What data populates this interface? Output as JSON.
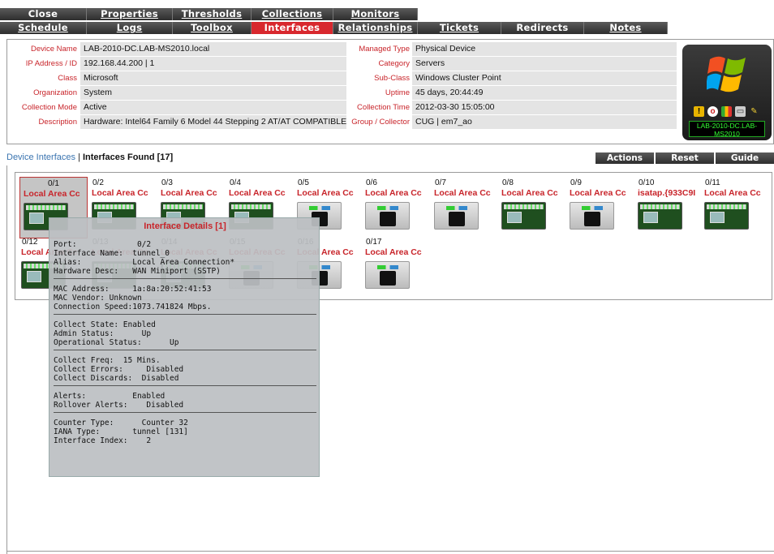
{
  "tabs_row1": [
    {
      "label": "Close",
      "underline": false
    },
    {
      "label": "Properties",
      "underline": true
    },
    {
      "label": "Thresholds",
      "underline": true
    },
    {
      "label": "Collections",
      "underline": true
    },
    {
      "label": "Monitors",
      "underline": true
    }
  ],
  "tabs_row2": [
    {
      "label": "Schedule",
      "underline": true,
      "active": false
    },
    {
      "label": "Logs",
      "underline": true,
      "active": false
    },
    {
      "label": "Toolbox",
      "underline": true,
      "active": false
    },
    {
      "label": "Interfaces",
      "underline": false,
      "active": true
    },
    {
      "label": "Relationships",
      "underline": true,
      "active": false
    },
    {
      "label": "Tickets",
      "underline": true,
      "active": false
    },
    {
      "label": "Redirects",
      "underline": false,
      "active": false
    },
    {
      "label": "Notes",
      "underline": true,
      "active": false
    }
  ],
  "device": {
    "left": [
      {
        "label": "Device Name",
        "value": "LAB-2010-DC.LAB-MS2010.local"
      },
      {
        "label": "IP Address / ID",
        "value": "192.168.44.200 | 1"
      },
      {
        "label": "Class",
        "value": "Microsoft"
      },
      {
        "label": "Organization",
        "value": "System"
      },
      {
        "label": "Collection Mode",
        "value": "Active"
      },
      {
        "label": "Description",
        "value": "Hardware: Intel64 Family 6 Model 44 Stepping 2 AT/AT COMPATIBLE -"
      }
    ],
    "right": [
      {
        "label": "Managed Type",
        "value": "Physical Device"
      },
      {
        "label": "Category",
        "value": "Servers"
      },
      {
        "label": "Sub-Class",
        "value": "Windows Cluster Point"
      },
      {
        "label": "Uptime",
        "value": "45 days, 20:44:49"
      },
      {
        "label": "Collection Time",
        "value": "2012-03-30 15:05:00"
      },
      {
        "label": "Group / Collector",
        "value": "CUG | em7_ao"
      }
    ],
    "badge_text": "LAB-2010-DC.LAB-MS2010"
  },
  "interfaces_header": {
    "link": "Device Interfaces",
    "separator": " | ",
    "found": "Interfaces Found [17]"
  },
  "header_buttons": {
    "actions": "Actions",
    "reset": "Reset",
    "guide": "Guide"
  },
  "interfaces": [
    {
      "num": "0/1",
      "name": "Local Area Cc",
      "type": "board"
    },
    {
      "num": "0/2",
      "name": "Local Area Cc",
      "type": "board"
    },
    {
      "num": "0/3",
      "name": "Local Area Cc",
      "type": "board"
    },
    {
      "num": "0/4",
      "name": "Local Area Cc",
      "type": "board"
    },
    {
      "num": "0/5",
      "name": "Local Area Cc",
      "type": "port"
    },
    {
      "num": "0/6",
      "name": "Local Area Cc",
      "type": "port"
    },
    {
      "num": "0/7",
      "name": "Local Area Cc",
      "type": "port"
    },
    {
      "num": "0/8",
      "name": "Local Area Cc",
      "type": "board"
    },
    {
      "num": "0/9",
      "name": "Local Area Cc",
      "type": "port"
    },
    {
      "num": "0/10",
      "name": "isatap.{933C9I",
      "type": "board"
    },
    {
      "num": "0/11",
      "name": "Local Area Cc",
      "type": "board"
    },
    {
      "num": "0/12",
      "name": "Local Area Cc",
      "type": "board"
    },
    {
      "num": "0/13",
      "name": "Local Area Cc",
      "type": "board"
    },
    {
      "num": "0/14",
      "name": "Local Area Cc",
      "type": "board"
    },
    {
      "num": "0/15",
      "name": "Local Area Cc",
      "type": "port"
    },
    {
      "num": "0/16",
      "name": "Local Area Cc",
      "type": "port"
    },
    {
      "num": "0/17",
      "name": "Local Area Cc",
      "type": "port"
    }
  ],
  "tooltip": {
    "title": "Interface Details [1]",
    "groups": [
      [
        "Port:             0/2",
        "Interface Name:  tunnel_0",
        "Alias:           Local Area Connection*",
        "Hardware Desc:   WAN Miniport (SSTP)"
      ],
      [
        "MAC Address:     1a:8a:20:52:41:53",
        "MAC Vendor: Unknown",
        "Connection Speed:1073.741824 Mbps."
      ],
      [
        "Collect State: Enabled",
        "Admin Status:      Up",
        "Operational Status:      Up"
      ],
      [
        "Collect Freq:  15 Mins.",
        "Collect Errors:     Disabled",
        "Collect Discards:  Disabled"
      ],
      [
        "Alerts:          Enabled",
        "Rollover Alerts:    Disabled"
      ],
      [
        "Counter Type:      Counter 32",
        "IANA Type:       tunnel [131]",
        "Interface Index:    2"
      ]
    ]
  }
}
